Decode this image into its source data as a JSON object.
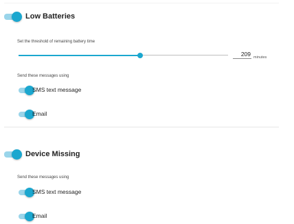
{
  "low_batteries": {
    "title": "Low Batteries",
    "enabled": true,
    "threshold_label": "Set the threshold of remaining battery time",
    "threshold_value": "209",
    "threshold_fraction": 0.58,
    "threshold_unit": "minutes",
    "send_label": "Send these messages using",
    "options": [
      {
        "label": "SMS text message",
        "enabled": true
      },
      {
        "label": "Email",
        "enabled": true
      }
    ]
  },
  "device_missing": {
    "title": "Device Missing",
    "enabled": true,
    "send_label": "Send these messages using",
    "options": [
      {
        "label": "SMS text message",
        "enabled": true
      },
      {
        "label": "Email",
        "enabled": true
      }
    ]
  },
  "colors": {
    "accent": "#1ba7cf",
    "accent_light": "#9ad5ea"
  }
}
